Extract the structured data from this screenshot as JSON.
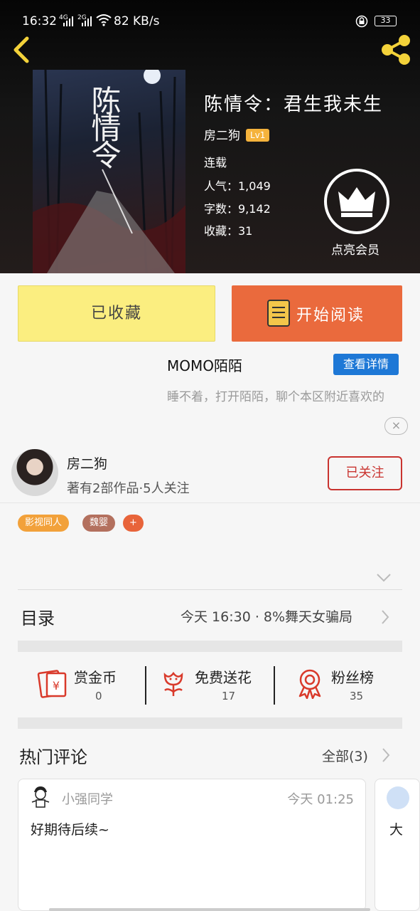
{
  "status_bar": {
    "time": "16:32",
    "signal_1": "4G",
    "signal_2": "2G",
    "speed": "82 KB/s",
    "battery": "33"
  },
  "book": {
    "title": "陈情令：君生我未生",
    "author": "房二狗",
    "author_level": "Lv1",
    "status": "连载",
    "popularity": "人气：1,049",
    "word_count": "字数：9,142",
    "collections": "收藏：31",
    "cover_title": "陈情令"
  },
  "vip": {
    "label": "点亮会员"
  },
  "actions": {
    "collected_label": "已收藏",
    "read_label": "开始阅读"
  },
  "ad": {
    "title": "MOMO陌陌",
    "detail_button": "查看详情",
    "description": "睡不着，打开陌陌，聊个本区附近喜欢的",
    "close_icon": "×"
  },
  "author_card": {
    "name": "房二狗",
    "stats": "著有2部作品·5人关注",
    "follow_label": "已关注",
    "tags": [
      {
        "label": "影视同人",
        "color": "#f2a13a"
      },
      {
        "label": "魏婴",
        "color": "#b3705e"
      },
      {
        "label": "+",
        "color": "#e8643a"
      }
    ]
  },
  "toc": {
    "title": "目录",
    "latest": "今天 16:30 · 8%舞天女骗局"
  },
  "stats": [
    {
      "icon": "red-envelope-icon",
      "label": "赏金币",
      "value": "0"
    },
    {
      "icon": "flower-icon",
      "label": "免费送花",
      "value": "17"
    },
    {
      "icon": "ribbon-medal-icon",
      "label": "粉丝榜",
      "value": "35"
    }
  ],
  "comments_section": {
    "title": "热门评论",
    "all_link": "全部(3)",
    "items": [
      {
        "user": "小强同学",
        "time": "今天 01:25",
        "text": "好期待后续~"
      },
      {
        "user": "",
        "time": "",
        "text": "大"
      }
    ]
  },
  "colors": {
    "accent_orange": "#ea6a3d",
    "collected_yellow": "#fbee80",
    "follow_red": "#c9332f",
    "ad_blue": "#1e78d6",
    "icon_yellow": "#f3d23a"
  }
}
